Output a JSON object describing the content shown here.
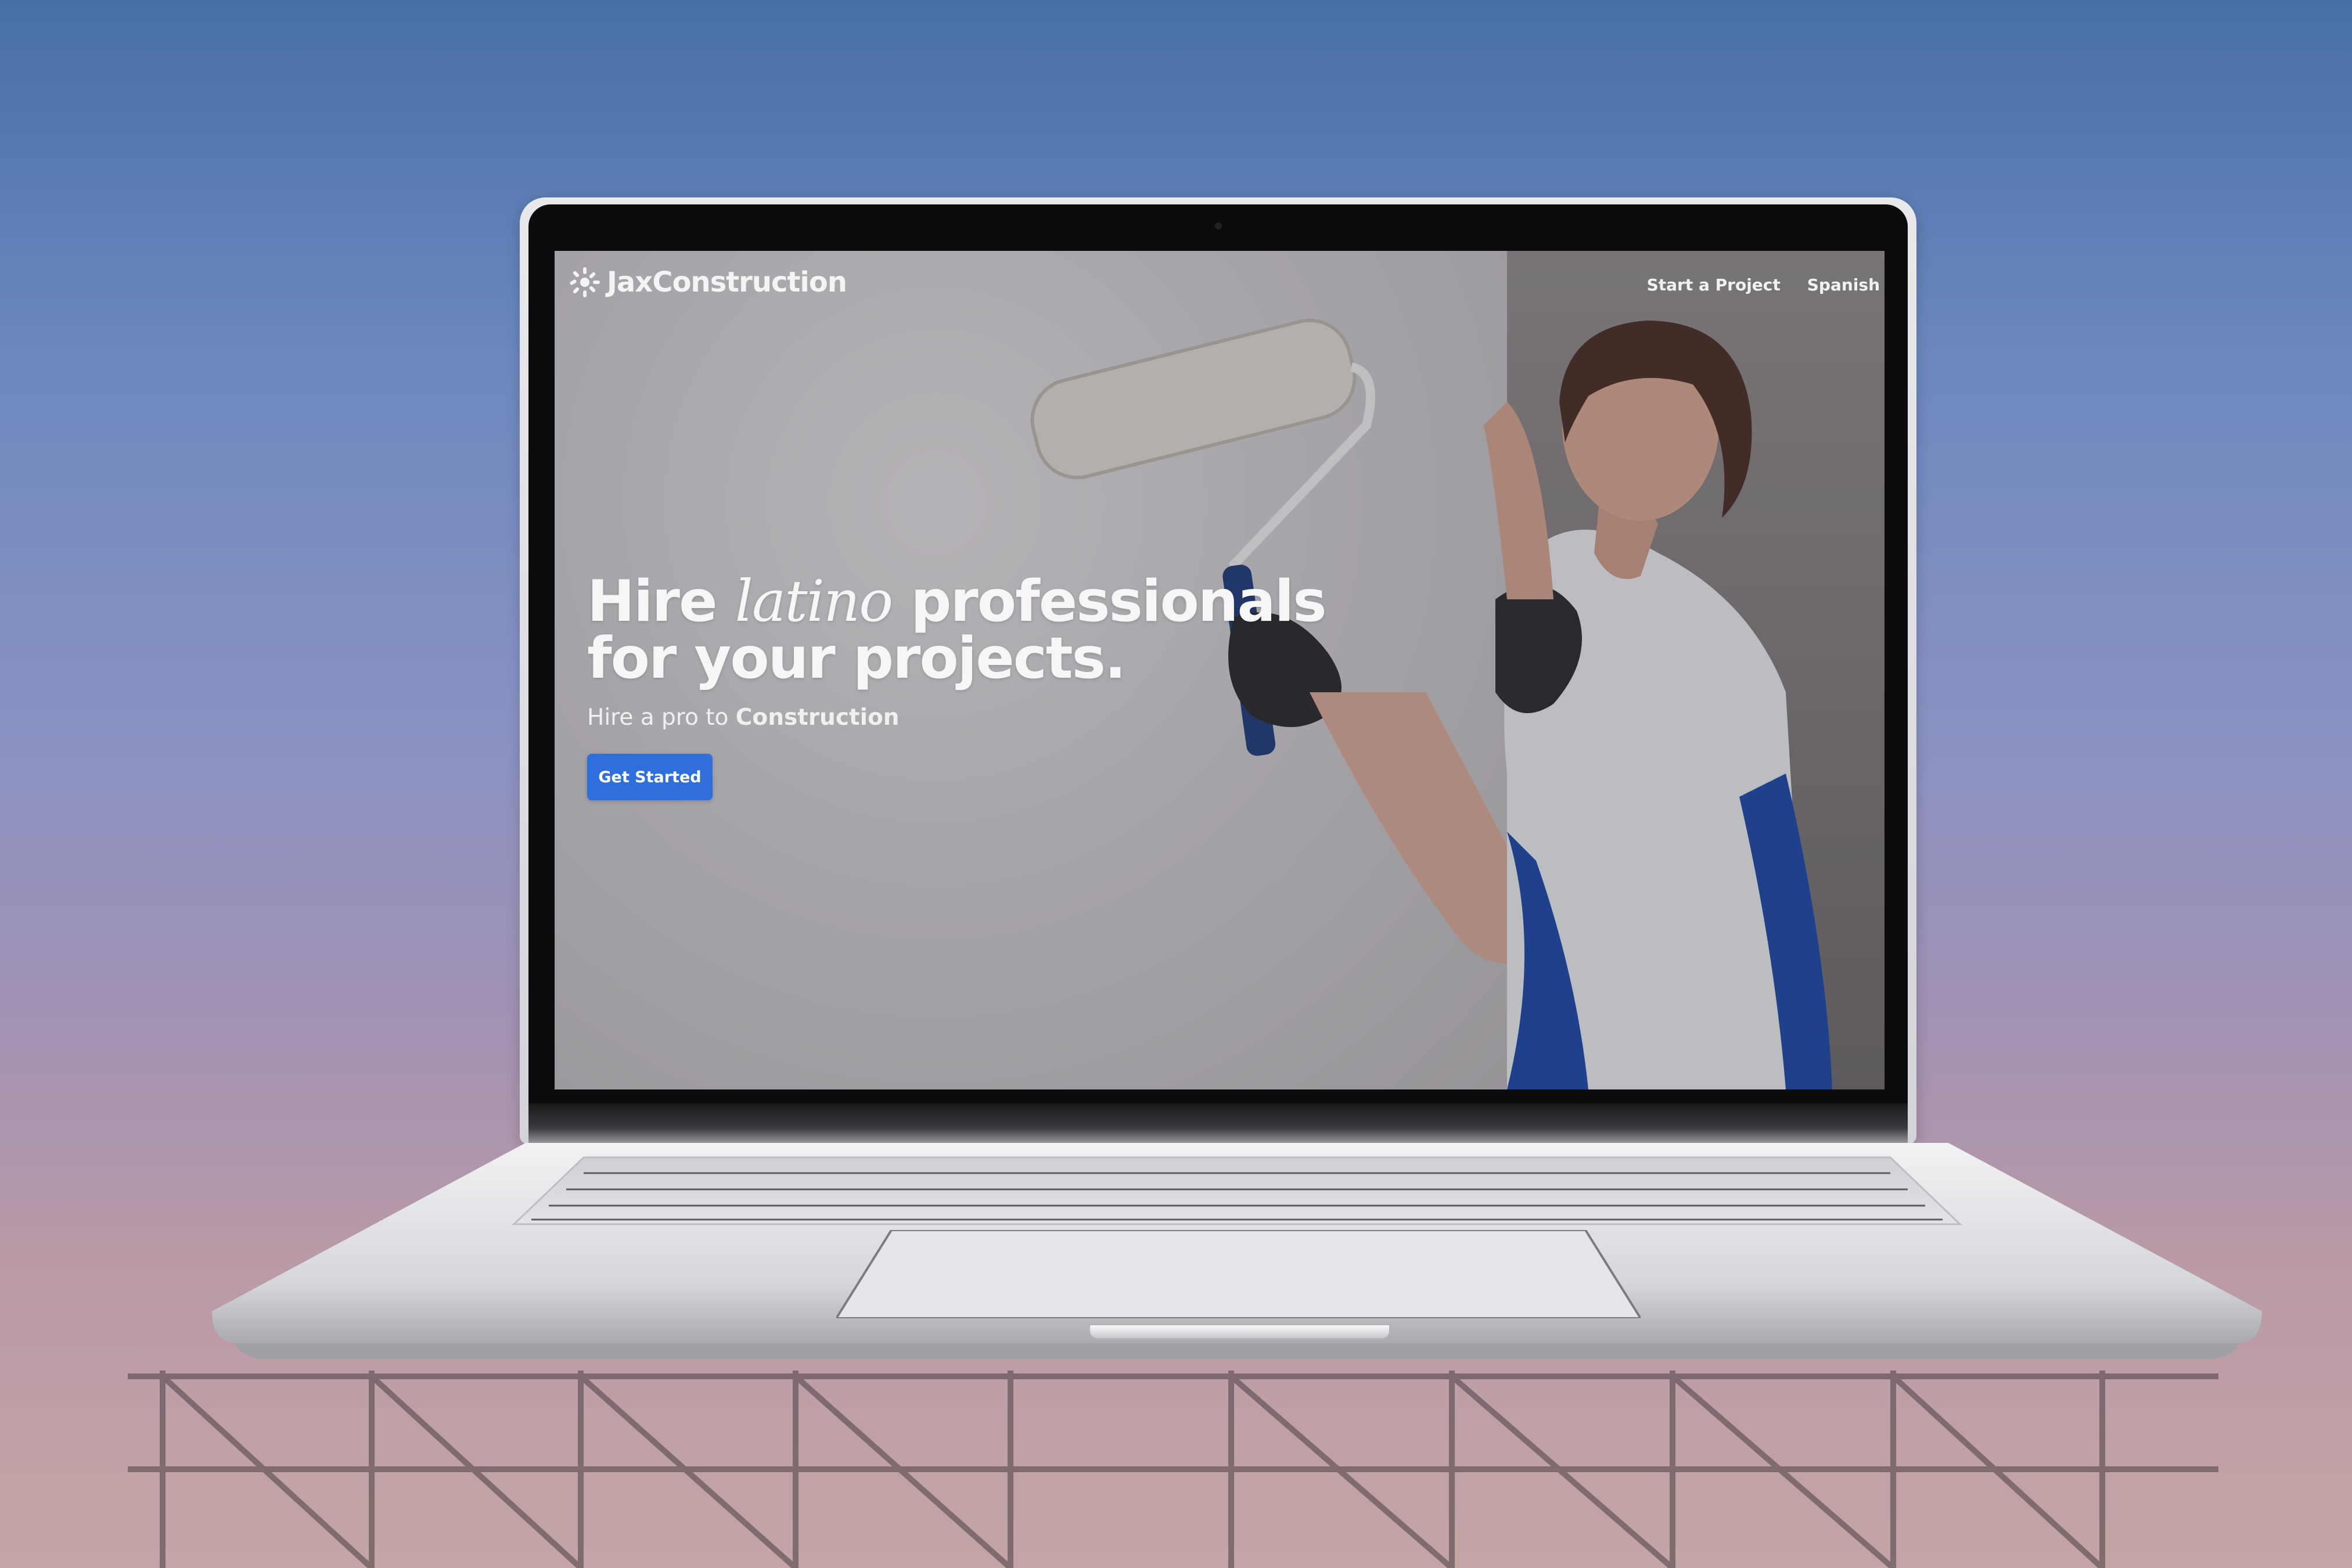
{
  "site": {
    "brand": "JaxConstruction",
    "nav": [
      {
        "label": "Start a Project"
      },
      {
        "label": "Spanish"
      }
    ]
  },
  "hero": {
    "headline_part1": "Hire ",
    "headline_italic": "latino",
    "headline_part2": " professionals",
    "headline_line2": "for your projects.",
    "subhead_prefix": "Hire a pro to ",
    "subhead_bold": "Construction",
    "cta_label": "Get Started"
  },
  "colors": {
    "accent": "#2f6fdc",
    "text": "#f6f6f6"
  },
  "icons": {
    "brand": "sun-burst-logo-icon"
  }
}
